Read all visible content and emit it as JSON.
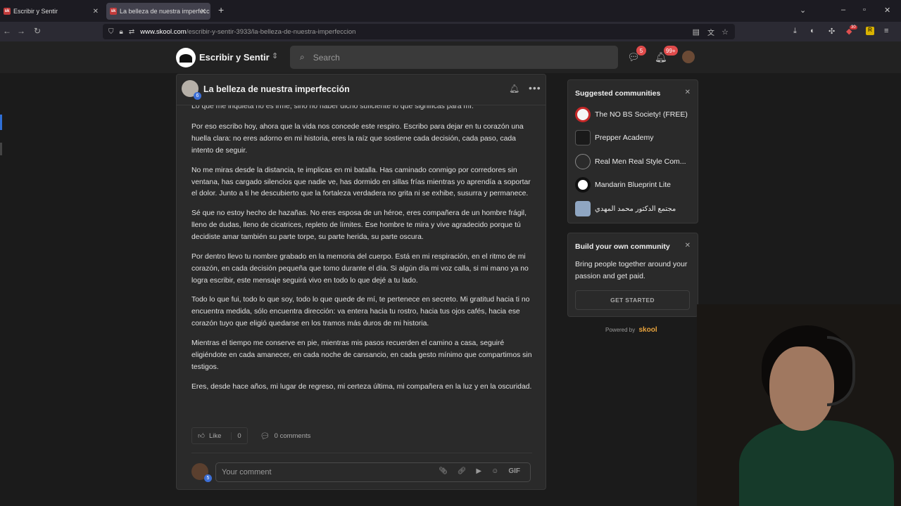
{
  "browser": {
    "tabs": [
      {
        "label": "Escribir y Sentir",
        "favicon": "sk"
      },
      {
        "label": "La belleza de nuestra imperfecc",
        "favicon": "sk"
      }
    ],
    "url_host": "www.skool.com",
    "url_path": "/escribir-y-sentir-3933/la-belleza-de-nuestra-imperfeccion",
    "ext_badge": "30"
  },
  "header": {
    "brand": "Escribir y Sentir",
    "search_placeholder": "Search",
    "chat_badge": "5",
    "notif_badge": "99+"
  },
  "post": {
    "title": "La belleza de nuestra imperfección",
    "author_level": "6",
    "cut_line": "Lo que me inquieta no es irme, sino no haber dicho suficiente lo que significas para mí.",
    "paragraphs": [
      "Por eso escribo hoy, ahora que la vida nos concede este respiro. Escribo para dejar en tu corazón una huella clara: no eres adorno en mi historia, eres la raíz que sostiene cada decisión, cada paso, cada intento de seguir.",
      "No me miras desde la distancia, te implicas en mi batalla. Has caminado conmigo por corredores sin ventana, has cargado silencios que nadie ve, has dormido en sillas frías mientras yo aprendía a soportar el dolor. Junto a ti he descubierto que la fortaleza verdadera no grita ni se exhibe, susurra y permanece.",
      "Sé que no estoy hecho de hazañas. No eres esposa de un héroe, eres compañera de un hombre frágil, lleno de dudas, lleno de cicatrices, repleto de límites. Ese hombre te mira y vive agradecido porque tú decidiste amar también su parte torpe, su parte herida, su parte oscura.",
      "Por dentro llevo tu nombre grabado en la memoria del cuerpo. Está en mi respiración, en el ritmo de mi corazón, en cada decisión pequeña que tomo durante el día. Si algún día mi voz calla, si mi mano ya no logra escribir, este mensaje seguirá vivo en todo lo que dejé a tu lado.",
      "Todo lo que fui, todo lo que soy, todo lo que quede de mí, te pertenece en secreto. Mi gratitud hacia ti no encuentra medida, sólo encuentra dirección: va entera hacia tu rostro, hacia tus ojos cafés, hacia ese corazón tuyo que eligió quedarse en los tramos más duros de mi historia.",
      "Mientras el tiempo me conserve en pie, mientras mis pasos recuerden el camino a casa, seguiré eligiéndote en cada amanecer, en cada noche de cansancio, en cada gesto mínimo que compartimos sin testigos.",
      "Eres, desde hace años, mi lugar de regreso, mi certeza última, mi compañera en la luz y en la oscuridad."
    ],
    "like_label": "Like",
    "like_count": "0",
    "comments_label": "0 comments",
    "comment_placeholder": "Your comment",
    "commenter_level": "5",
    "gif_label": "GIF"
  },
  "sidebar": {
    "suggested_title": "Suggested communities",
    "communities": [
      {
        "name": "The NO BS Society! (FREE)",
        "color": "#f5f5f5"
      },
      {
        "name": "Prepper Academy",
        "color": "#1a1a1a"
      },
      {
        "name": "Real Men Real Style Com...",
        "color": "#2b2b2b"
      },
      {
        "name": "Mandarin Blueprint Lite",
        "color": "#ffffff"
      },
      {
        "name": "مجتمع الدكتور محمد المهدي",
        "color": "#8fa6c2"
      }
    ],
    "build_title": "Build your own community",
    "build_text": "Bring people together around your passion and get paid.",
    "build_button": "GET STARTED",
    "powered_by": "Powered by",
    "powered_brand": "skool"
  }
}
